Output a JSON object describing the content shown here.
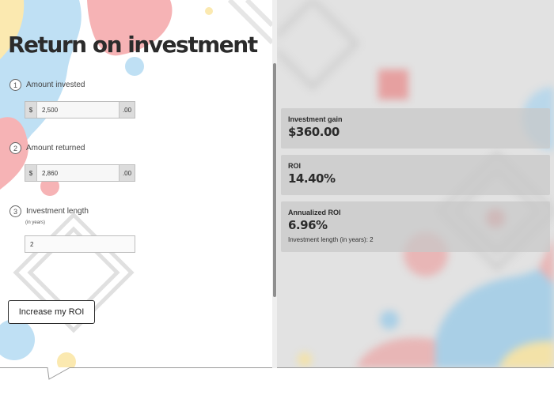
{
  "calculator": {
    "title": "Return on investment",
    "steps": [
      {
        "number": "1",
        "label": "Amount invested",
        "prefix": "$",
        "value": "2,500",
        "suffix": ".00"
      },
      {
        "number": "2",
        "label": "Amount returned",
        "prefix": "$",
        "value": "2,860",
        "suffix": ".00"
      },
      {
        "number": "3",
        "label": "Investment length",
        "sublabel": "(in years)",
        "value": "2"
      }
    ],
    "button_label": "Increase my ROI"
  },
  "results": [
    {
      "label": "Investment gain",
      "value": "$360.00"
    },
    {
      "label": "ROI",
      "value": "14.40%"
    },
    {
      "label": "Annualized ROI",
      "value": "6.96%",
      "note": "Investment length (in years): 2"
    }
  ],
  "colors": {
    "blue_blob": "#bfe0f4",
    "pink_blob": "#f6b3b5",
    "yellow_blob": "#fbe9b0",
    "red_square": "#e6a0a0",
    "text_dark": "#2b2b2b",
    "results_bg": "#e2e2e2"
  }
}
